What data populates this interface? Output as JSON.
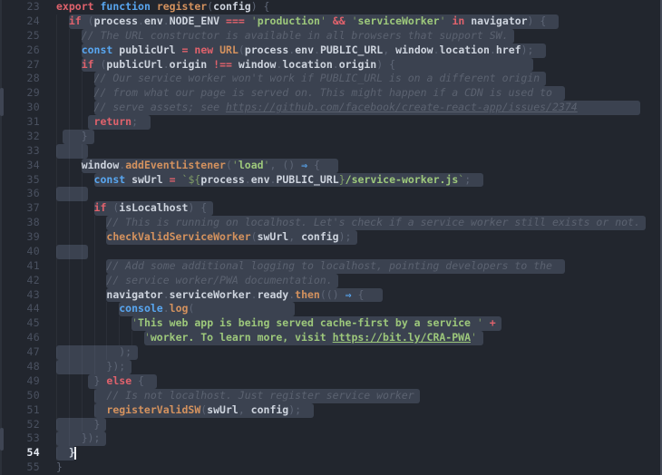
{
  "editor": {
    "language": "javascript",
    "active_line": 54,
    "cursor": {
      "line": 54,
      "col": 3
    },
    "palette": {
      "background": "#22262e",
      "selection": "#3b4250",
      "keyword": "#e0626c",
      "declaration_blue": "#58a6f0",
      "function_name": "#d4925e",
      "string": "#9dc87b",
      "string_quote": "#7f9c66",
      "comment": "#5b6270",
      "identifier": "#ced4de",
      "punctuation": "#5d6575",
      "line_number": "#4a5160",
      "line_number_active": "#e6ebf4",
      "cursor": "#eef2f8"
    },
    "lines": [
      {
        "n": 23,
        "ind": 0,
        "sel": null,
        "t": [
          [
            "export",
            "k"
          ],
          [
            " ",
            "p"
          ],
          [
            "function",
            "b"
          ],
          [
            " ",
            "p"
          ],
          [
            "register",
            "o"
          ],
          [
            "(",
            "p"
          ],
          [
            "config",
            "w"
          ],
          [
            ") {",
            "p"
          ]
        ]
      },
      {
        "n": 24,
        "ind": 2,
        "sel": [
          2,
          80
        ],
        "t": [
          [
            "if",
            "k"
          ],
          [
            " (",
            "p"
          ],
          [
            "process",
            "w"
          ],
          [
            ".",
            "p"
          ],
          [
            "env",
            "w"
          ],
          [
            ".",
            "p"
          ],
          [
            "NODE_ENV",
            "w"
          ],
          [
            " ",
            "p"
          ],
          [
            "===",
            "k"
          ],
          [
            " ",
            "p"
          ],
          [
            "'",
            "q"
          ],
          [
            "production",
            "s"
          ],
          [
            "'",
            "q"
          ],
          [
            " ",
            "p"
          ],
          [
            "&&",
            "k"
          ],
          [
            " ",
            "p"
          ],
          [
            "'",
            "q"
          ],
          [
            "serviceWorker",
            "s"
          ],
          [
            "'",
            "q"
          ],
          [
            " ",
            "p"
          ],
          [
            "in",
            "k"
          ],
          [
            " ",
            "p"
          ],
          [
            "navigator",
            "w"
          ],
          [
            ") {",
            "p"
          ]
        ]
      },
      {
        "n": 25,
        "ind": 4,
        "sel": [
          4,
          73
        ],
        "t": [
          [
            "// The URL constructor is available in all browsers that support SW.",
            "c"
          ]
        ]
      },
      {
        "n": 26,
        "ind": 4,
        "sel": [
          4,
          78
        ],
        "t": [
          [
            "const",
            "b"
          ],
          [
            " ",
            "p"
          ],
          [
            "publicUrl",
            "w"
          ],
          [
            " ",
            "p"
          ],
          [
            "=",
            "k"
          ],
          [
            " ",
            "p"
          ],
          [
            "new",
            "k"
          ],
          [
            " ",
            "p"
          ],
          [
            "URL",
            "o"
          ],
          [
            "(",
            "p"
          ],
          [
            "process",
            "w"
          ],
          [
            ".",
            "p"
          ],
          [
            "env",
            "w"
          ],
          [
            ".",
            "p"
          ],
          [
            "PUBLIC_URL",
            "w"
          ],
          [
            ", ",
            "p"
          ],
          [
            "window",
            "w"
          ],
          [
            ".",
            "p"
          ],
          [
            "location",
            "w"
          ],
          [
            ".",
            "p"
          ],
          [
            "href",
            "w"
          ],
          [
            ");",
            "p"
          ]
        ]
      },
      {
        "n": 27,
        "ind": 4,
        "sel": [
          4,
          76
        ],
        "t": [
          [
            "if",
            "k"
          ],
          [
            " (",
            "p"
          ],
          [
            "publicUrl",
            "w"
          ],
          [
            ".",
            "p"
          ],
          [
            "origin",
            "w"
          ],
          [
            " ",
            "p"
          ],
          [
            "!==",
            "k"
          ],
          [
            " ",
            "p"
          ],
          [
            "window",
            "w"
          ],
          [
            ".",
            "p"
          ],
          [
            "location",
            "w"
          ],
          [
            ".",
            "p"
          ],
          [
            "origin",
            "w"
          ],
          [
            ") {",
            "p"
          ]
        ]
      },
      {
        "n": 28,
        "ind": 6,
        "sel": [
          6,
          78
        ],
        "t": [
          [
            "// Our service worker won't work if PUBLIC_URL is on a different origin",
            "c"
          ]
        ]
      },
      {
        "n": 29,
        "ind": 6,
        "sel": [
          6,
          81
        ],
        "t": [
          [
            "// from what our page is served on. This might happen if a CDN is used to",
            "c"
          ]
        ]
      },
      {
        "n": 30,
        "ind": 6,
        "sel": [
          6,
          93
        ],
        "t": [
          [
            "// serve assets; see ",
            "c"
          ],
          [
            "https://github.com/facebook/create-react-app/issues/2374",
            "cu"
          ]
        ]
      },
      {
        "n": 31,
        "ind": 6,
        "sel": [
          5,
          15
        ],
        "t": [
          [
            "return",
            "k"
          ],
          [
            ";",
            "p"
          ]
        ]
      },
      {
        "n": 32,
        "ind": 4,
        "sel": [
          1,
          6
        ],
        "t": [
          [
            "}",
            "p"
          ]
        ]
      },
      {
        "n": 33,
        "ind": 6,
        "sel": [
          0,
          5
        ],
        "t": []
      },
      {
        "n": 34,
        "ind": 4,
        "sel": [
          4,
          45
        ],
        "t": [
          [
            "window",
            "w"
          ],
          [
            ".",
            "p"
          ],
          [
            "addEventListener",
            "o"
          ],
          [
            "(",
            "p"
          ],
          [
            "'",
            "q"
          ],
          [
            "load",
            "s"
          ],
          [
            "'",
            "q"
          ],
          [
            ", ",
            "p"
          ],
          [
            "()",
            "p"
          ],
          [
            " ",
            "p"
          ],
          [
            "⇒",
            "b"
          ],
          [
            " {",
            "p"
          ]
        ]
      },
      {
        "n": 35,
        "ind": 6,
        "sel": [
          6,
          68
        ],
        "t": [
          [
            "const",
            "b"
          ],
          [
            " ",
            "p"
          ],
          [
            "swUrl",
            "w"
          ],
          [
            " ",
            "p"
          ],
          [
            "=",
            "k"
          ],
          [
            " ",
            "p"
          ],
          [
            "`${",
            "q"
          ],
          [
            "process",
            "w"
          ],
          [
            ".",
            "p"
          ],
          [
            "env",
            "w"
          ],
          [
            ".",
            "p"
          ],
          [
            "PUBLIC_URL",
            "w"
          ],
          [
            "}",
            "q"
          ],
          [
            "/service-worker.js",
            "s"
          ],
          [
            "`",
            "q"
          ],
          [
            ";",
            "p"
          ]
        ]
      },
      {
        "n": 36,
        "ind": 6,
        "sel": [
          0,
          5
        ],
        "t": []
      },
      {
        "n": 37,
        "ind": 6,
        "sel": [
          6,
          25
        ],
        "t": [
          [
            "if",
            "k"
          ],
          [
            " (",
            "p"
          ],
          [
            "isLocalhost",
            "w"
          ],
          [
            ") {",
            "p"
          ]
        ]
      },
      {
        "n": 38,
        "ind": 8,
        "sel": [
          8,
          94
        ],
        "t": [
          [
            "// This is running on localhost. Let's check if a service worker still exists or not.",
            "c"
          ]
        ]
      },
      {
        "n": 39,
        "ind": 8,
        "sel": [
          8,
          48
        ],
        "t": [
          [
            "checkValidServiceWorker",
            "o"
          ],
          [
            "(",
            "p"
          ],
          [
            "swUrl",
            "w"
          ],
          [
            ", ",
            "p"
          ],
          [
            "config",
            "w"
          ],
          [
            ");",
            "p"
          ]
        ]
      },
      {
        "n": 40,
        "ind": 8,
        "sel": [
          0,
          5
        ],
        "t": []
      },
      {
        "n": 41,
        "ind": 8,
        "sel": [
          8,
          81
        ],
        "t": [
          [
            "// Add some additional logging to localhost, pointing developers to the",
            "c"
          ]
        ]
      },
      {
        "n": 42,
        "ind": 8,
        "sel": [
          8,
          45
        ],
        "t": [
          [
            "// service worker/PWA documentation.",
            "c"
          ]
        ]
      },
      {
        "n": 43,
        "ind": 8,
        "sel": [
          8,
          52
        ],
        "t": [
          [
            "navigator",
            "w"
          ],
          [
            ".",
            "p"
          ],
          [
            "serviceWorker",
            "w"
          ],
          [
            ".",
            "p"
          ],
          [
            "ready",
            "w"
          ],
          [
            ".",
            "p"
          ],
          [
            "then",
            "o"
          ],
          [
            "(()",
            "p"
          ],
          [
            " ",
            "p"
          ],
          [
            "⇒",
            "b"
          ],
          [
            " {",
            "p"
          ]
        ]
      },
      {
        "n": 44,
        "ind": 10,
        "sel": [
          10,
          38
        ],
        "t": [
          [
            "console",
            "b"
          ],
          [
            ".",
            "p"
          ],
          [
            "log",
            "o"
          ],
          [
            "(",
            "p"
          ]
        ]
      },
      {
        "n": 45,
        "ind": 12,
        "sel": [
          12,
          71
        ],
        "t": [
          [
            "'",
            "q"
          ],
          [
            "This web app is being served cache-first by a service ",
            "s"
          ],
          [
            "'",
            "q"
          ],
          [
            " ",
            "p"
          ],
          [
            "+",
            "k"
          ]
        ]
      },
      {
        "n": 46,
        "ind": 14,
        "sel": [
          14,
          68
        ],
        "t": [
          [
            "'",
            "q"
          ],
          [
            "worker. To learn more, visit ",
            "s"
          ],
          [
            "https://bit.ly/CRA-PWA",
            "su"
          ],
          [
            "'",
            "q"
          ]
        ]
      },
      {
        "n": 47,
        "ind": 10,
        "sel": [
          0,
          13
        ],
        "t": [
          [
            ");",
            "p"
          ]
        ]
      },
      {
        "n": 48,
        "ind": 8,
        "sel": [
          0,
          12
        ],
        "t": [
          [
            "});",
            "p"
          ]
        ]
      },
      {
        "n": 49,
        "ind": 6,
        "sel": [
          5,
          16
        ],
        "t": [
          [
            "}",
            "p"
          ],
          [
            " ",
            "p"
          ],
          [
            "else",
            "k"
          ],
          [
            " {",
            "p"
          ]
        ]
      },
      {
        "n": 50,
        "ind": 8,
        "sel": [
          6,
          58
        ],
        "t": [
          [
            "// Is not localhost. Just register service worker",
            "c"
          ]
        ]
      },
      {
        "n": 51,
        "ind": 8,
        "sel": [
          6,
          41
        ],
        "t": [
          [
            "registerValidSW",
            "o"
          ],
          [
            "(",
            "p"
          ],
          [
            "swUrl",
            "w"
          ],
          [
            ", ",
            "p"
          ],
          [
            "config",
            "w"
          ],
          [
            ");",
            "p"
          ]
        ]
      },
      {
        "n": 52,
        "ind": 6,
        "sel": [
          0,
          8
        ],
        "t": [
          [
            "}",
            "p"
          ]
        ]
      },
      {
        "n": 53,
        "ind": 4,
        "sel": [
          0,
          8
        ],
        "t": [
          [
            "});",
            "p"
          ]
        ]
      },
      {
        "n": 54,
        "ind": 2,
        "sel": [
          0,
          3
        ],
        "cursor": 3,
        "t": [
          [
            "}",
            "w"
          ]
        ]
      },
      {
        "n": 55,
        "ind": 0,
        "sel": null,
        "t": [
          [
            "}",
            "p"
          ]
        ]
      }
    ]
  }
}
